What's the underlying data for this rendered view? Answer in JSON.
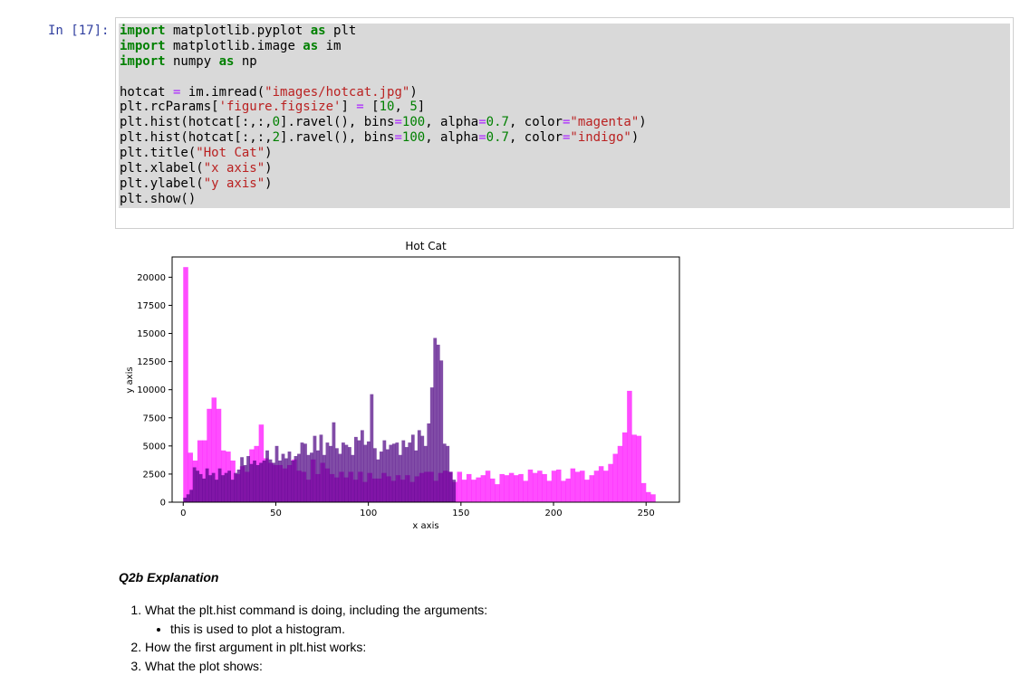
{
  "cell": {
    "prompt": "In [17]:",
    "code_lines": [
      [
        {
          "t": "import",
          "c": "kw"
        },
        {
          "t": " matplotlib.pyplot "
        },
        {
          "t": "as",
          "c": "kw"
        },
        {
          "t": " plt"
        }
      ],
      [
        {
          "t": "import",
          "c": "kw"
        },
        {
          "t": " matplotlib.image "
        },
        {
          "t": "as",
          "c": "kw"
        },
        {
          "t": " im"
        }
      ],
      [
        {
          "t": "import",
          "c": "kw"
        },
        {
          "t": " numpy "
        },
        {
          "t": "as",
          "c": "kw"
        },
        {
          "t": " np"
        }
      ],
      [
        {
          "t": ""
        }
      ],
      [
        {
          "t": "hotcat "
        },
        {
          "t": "=",
          "c": "op"
        },
        {
          "t": " im.imread("
        },
        {
          "t": "\"images/hotcat.jpg\"",
          "c": "str"
        },
        {
          "t": ")"
        }
      ],
      [
        {
          "t": "plt.rcParams["
        },
        {
          "t": "'figure.figsize'",
          "c": "str"
        },
        {
          "t": "] "
        },
        {
          "t": "=",
          "c": "op"
        },
        {
          "t": " ["
        },
        {
          "t": "10",
          "c": "num"
        },
        {
          "t": ", "
        },
        {
          "t": "5",
          "c": "num"
        },
        {
          "t": "]"
        }
      ],
      [
        {
          "t": "plt.hist(hotcat[:,:,"
        },
        {
          "t": "0",
          "c": "num"
        },
        {
          "t": "].ravel(), bins"
        },
        {
          "t": "=",
          "c": "op"
        },
        {
          "t": "100",
          "c": "num"
        },
        {
          "t": ", alpha"
        },
        {
          "t": "=",
          "c": "op"
        },
        {
          "t": "0.7",
          "c": "num"
        },
        {
          "t": ", color"
        },
        {
          "t": "=",
          "c": "op"
        },
        {
          "t": "\"magenta\"",
          "c": "str"
        },
        {
          "t": ")"
        }
      ],
      [
        {
          "t": "plt.hist(hotcat[:,:,"
        },
        {
          "t": "2",
          "c": "num"
        },
        {
          "t": "].ravel(), bins"
        },
        {
          "t": "=",
          "c": "op"
        },
        {
          "t": "100",
          "c": "num"
        },
        {
          "t": ", alpha"
        },
        {
          "t": "=",
          "c": "op"
        },
        {
          "t": "0.7",
          "c": "num"
        },
        {
          "t": ", color"
        },
        {
          "t": "=",
          "c": "op"
        },
        {
          "t": "\"indigo\"",
          "c": "str"
        },
        {
          "t": ")"
        }
      ],
      [
        {
          "t": "plt.title("
        },
        {
          "t": "\"Hot Cat\"",
          "c": "str"
        },
        {
          "t": ")"
        }
      ],
      [
        {
          "t": "plt.xlabel("
        },
        {
          "t": "\"x axis\"",
          "c": "str"
        },
        {
          "t": ")"
        }
      ],
      [
        {
          "t": "plt.ylabel("
        },
        {
          "t": "\"y axis\"",
          "c": "str"
        },
        {
          "t": ")"
        }
      ],
      [
        {
          "t": "plt.show()"
        }
      ]
    ]
  },
  "chart_data": {
    "type": "bar",
    "title": "Hot Cat",
    "xlabel": "x axis",
    "ylabel": "y axis",
    "xlim": [
      -6,
      268
    ],
    "ylim": [
      0,
      21800
    ],
    "xticks": [
      0,
      50,
      100,
      150,
      200,
      250
    ],
    "yticks": [
      0,
      2500,
      5000,
      7500,
      10000,
      12500,
      15000,
      17500,
      20000
    ],
    "alpha": 0.7,
    "series": [
      {
        "color": "#ff00ff",
        "bin_edges_start": 0,
        "bin_width": 2.55,
        "values": [
          20900,
          4400,
          3700,
          5500,
          5500,
          8300,
          9300,
          8300,
          4600,
          4500,
          3700,
          2500,
          3200,
          2700,
          4700,
          5000,
          6900,
          3900,
          3500,
          3300,
          3300,
          3000,
          3300,
          3800,
          2800,
          2700,
          2000,
          3800,
          2500,
          3500,
          3000,
          2500,
          2200,
          2700,
          2200,
          2700,
          2000,
          2700,
          1800,
          2600,
          2100,
          2100,
          2600,
          2300,
          1900,
          2400,
          2000,
          2400,
          1800,
          2300,
          2600,
          2700,
          2700,
          1900,
          2600,
          2800,
          2700,
          1800,
          2700,
          2000,
          2500,
          2000,
          2200,
          2400,
          2800,
          2100,
          1600,
          2500,
          2400,
          2600,
          2400,
          2500,
          1900,
          2900,
          2600,
          2800,
          2500,
          1900,
          2800,
          2900,
          1900,
          2100,
          3000,
          2700,
          2800,
          2000,
          2400,
          2800,
          3200,
          2800,
          3400,
          4300,
          5000,
          6200,
          9900,
          6000,
          5900,
          1700,
          900,
          700
        ]
      },
      {
        "color": "#4b0082",
        "bin_edges_start": 0,
        "bin_width": 1.71,
        "values": [
          400,
          700,
          1100,
          3100,
          2800,
          2500,
          2100,
          3000,
          2400,
          2600,
          2000,
          3000,
          2400,
          2600,
          2800,
          2000,
          2600,
          2900,
          4000,
          3300,
          4100,
          3400,
          3700,
          3300,
          3500,
          3700,
          4600,
          3800,
          3500,
          5000,
          3700,
          4300,
          3900,
          4500,
          3700,
          4100,
          4300,
          5300,
          5200,
          4200,
          4400,
          5900,
          4600,
          6000,
          4200,
          5300,
          5000,
          7100,
          4800,
          4300,
          5300,
          5100,
          4900,
          4200,
          5800,
          5500,
          6400,
          5100,
          5400,
          9600,
          4800,
          3800,
          4500,
          5500,
          4700,
          5100,
          5200,
          5300,
          4200,
          5500,
          4900,
          5300,
          6000,
          4600,
          6400,
          5900,
          5000,
          7000,
          10200,
          14600,
          14000,
          12600,
          5200,
          5000,
          2700,
          2000
        ]
      }
    ]
  },
  "markdown": {
    "heading": "Q2b Explanation",
    "items": [
      "What the plt.hist command is doing, including the arguments:",
      "How the first argument in plt.hist works:",
      "What the plot shows:"
    ],
    "sub_item": "this is used to plot a histogram."
  }
}
